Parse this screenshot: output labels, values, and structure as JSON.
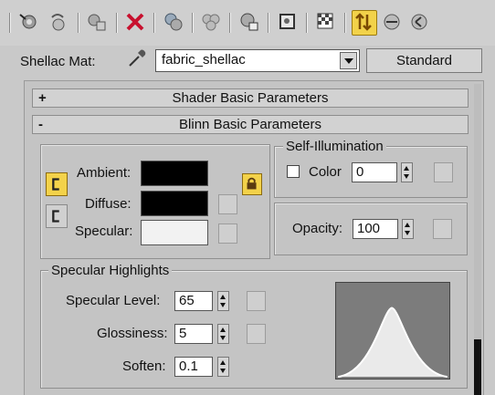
{
  "toolbar": {
    "icons": [
      "get-material-icon",
      "put-to-scene-icon",
      "assign-to-selection-icon",
      "reset-map-icon",
      "make-unique-icon",
      "put-to-library-icon",
      "material-id-channel-icon",
      "show-map-icon",
      "show-end-result-icon",
      "go-to-parent-icon",
      "go-forward-to-sibling-icon"
    ]
  },
  "material": {
    "label": "Shellac Mat:",
    "name": "fabric_shellac",
    "type_button": "Standard"
  },
  "rollouts": {
    "shader_basic": {
      "sign": "+",
      "title": "Shader Basic Parameters"
    },
    "blinn_basic": {
      "sign": "-",
      "title": "Blinn Basic Parameters"
    }
  },
  "colors": {
    "ambient_label": "Ambient:",
    "diffuse_label": "Diffuse:",
    "specular_label": "Specular:",
    "ambient_color": "#000000",
    "diffuse_color": "#000000",
    "specular_color": "#f2f2f2"
  },
  "self_illumination": {
    "legend": "Self-Illumination",
    "color_label": "Color",
    "color_checked": false,
    "value": "0"
  },
  "opacity": {
    "label": "Opacity:",
    "value": "100"
  },
  "specular_highlights": {
    "legend": "Specular Highlights",
    "specular_level_label": "Specular Level:",
    "specular_level": "65",
    "glossiness_label": "Glossiness:",
    "glossiness": "5",
    "soften_label": "Soften:",
    "soften": "0.1"
  }
}
